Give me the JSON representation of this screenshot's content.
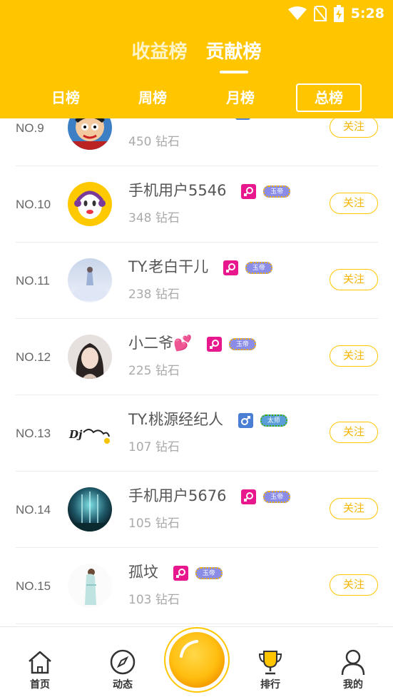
{
  "status_bar": {
    "time": "5:28"
  },
  "main_tabs": [
    {
      "label": "收益榜",
      "active": false
    },
    {
      "label": "贡献榜",
      "active": true
    }
  ],
  "period_tabs": [
    {
      "label": "日榜"
    },
    {
      "label": "周榜"
    },
    {
      "label": "月榜"
    },
    {
      "label": "总榜",
      "active": true
    }
  ],
  "ranking": [
    {
      "rank": "NO.9",
      "name": "",
      "diamonds": "450 钻石",
      "gender": "male",
      "level": "",
      "follow": "关注"
    },
    {
      "rank": "NO.10",
      "name": "手机用户5546",
      "diamonds": "348 钻石",
      "gender": "female",
      "level": "玉帝",
      "follow": "关注"
    },
    {
      "rank": "NO.11",
      "name": "TY.老白干儿",
      "diamonds": "238 钻石",
      "gender": "female",
      "level": "玉帝",
      "follow": "关注"
    },
    {
      "rank": "NO.12",
      "name": "小二爷💕",
      "diamonds": "225 钻石",
      "gender": "female",
      "level": "玉帝",
      "follow": "关注"
    },
    {
      "rank": "NO.13",
      "name": "TY.桃源经纪人",
      "diamonds": "107 钻石",
      "gender": "male",
      "level": "太师",
      "follow": "关注"
    },
    {
      "rank": "NO.14",
      "name": "手机用户5676",
      "diamonds": "105 钻石",
      "gender": "female",
      "level": "玉帝",
      "follow": "关注"
    },
    {
      "rank": "NO.15",
      "name": "孤坟",
      "diamonds": "103 钻石",
      "gender": "female",
      "level": "玉帝",
      "follow": "关注"
    }
  ],
  "bottom_nav": [
    {
      "label": "首页",
      "icon": "home-icon"
    },
    {
      "label": "动态",
      "icon": "compass-icon"
    },
    {
      "label": "排行",
      "icon": "trophy-icon"
    },
    {
      "label": "我的",
      "icon": "user-icon"
    }
  ],
  "colors": {
    "brand": "#ffc600",
    "female": "#e8178e",
    "male": "#4a7fd4"
  }
}
